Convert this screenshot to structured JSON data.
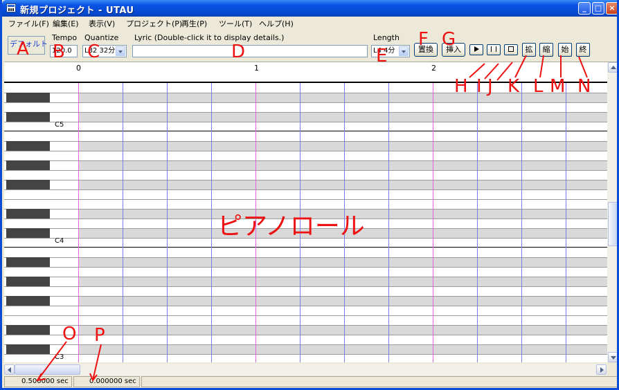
{
  "window": {
    "title": "新規プロジェクト - UTAU"
  },
  "titlebar_buttons": {
    "minimize": "_",
    "maximize": "□",
    "close": "×"
  },
  "menu": [
    "ファイル(F)",
    "編集(E)",
    "表示(V)",
    "プロジェクト(P)",
    "再生(P)",
    "ツール(T)",
    "ヘルプ(H)"
  ],
  "toolbar": {
    "preset": "デフォルト",
    "tempo_label": "Tempo",
    "tempo_value": "120.0",
    "quantize_label": "Quantize",
    "quantize_value": "L32 32分",
    "lyric_label": "Lyric (Double-click it to display details.)",
    "lyric_value": "",
    "length_label": "Length",
    "length_value": "L4  4分",
    "replace_button": "置換",
    "insert_button": "挿入",
    "zoom_in": "拡",
    "zoom_out": "縮",
    "start": "始",
    "end": "終"
  },
  "ruler": {
    "marks": [
      "0",
      "1",
      "2"
    ]
  },
  "keys": {
    "labels": [
      "C5",
      "C4",
      "C3"
    ]
  },
  "status": {
    "total_time": "0.500000 sec",
    "cursor_time": "0.000000 sec"
  },
  "annotations": {
    "A": "A",
    "B": "B",
    "C": "C",
    "D": "D",
    "E": "E",
    "F": "F",
    "G": "G",
    "H": "H",
    "I": "I",
    "J": "J",
    "K": "K",
    "L": "L",
    "M": "M",
    "N": "N",
    "O": "O",
    "P": "P",
    "piano_roll": "ピアノロール"
  },
  "colors": {
    "bar_line": "#e060e0",
    "beat_line": "#7c7cf0",
    "annotation": "#ee1111",
    "title_bar": "#0b53e4"
  }
}
